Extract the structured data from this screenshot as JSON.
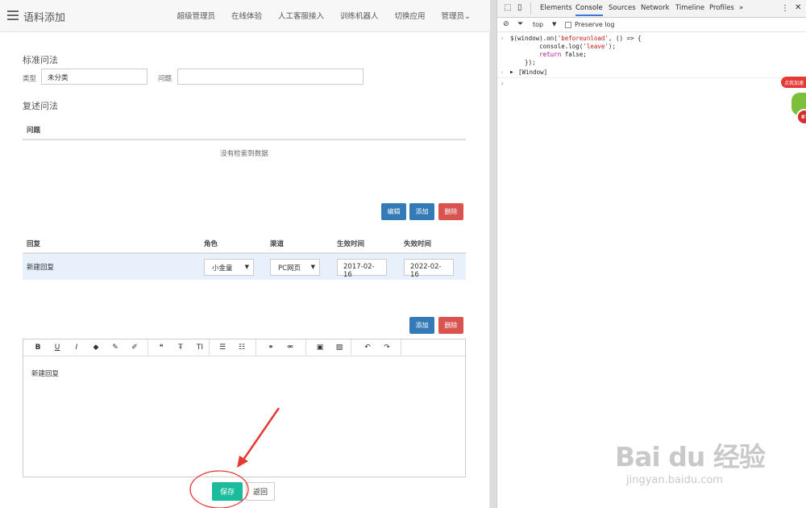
{
  "app": {
    "title": "语料添加",
    "nav": [
      "超级管理员",
      "在线体验",
      "人工客服接入",
      "训练机器人",
      "切换应用",
      "管理员"
    ]
  },
  "standard": {
    "heading": "标准问法",
    "type_label": "类型",
    "type_value": "未分类",
    "question_label": "问题",
    "question_value": ""
  },
  "paraphrase": {
    "heading": "复述问法",
    "column": "问题",
    "empty_text": "没有检索到数据",
    "edit_button": "编辑",
    "add_button": "添加",
    "delete_button": "删除"
  },
  "reply_table": {
    "headers": [
      "回复",
      "角色",
      "渠道",
      "生效时间",
      "失效时间"
    ],
    "row": {
      "reply": "新建回复",
      "role": "小金童",
      "channel": "PC网页",
      "start": "2017-02-16",
      "end": "2022-02-16"
    },
    "add_button": "添加",
    "delete_button": "删除"
  },
  "editor": {
    "toolbar_icons": [
      "bold-icon",
      "underline-icon",
      "italic-icon",
      "eraser-icon",
      "pencil-icon",
      "brush-icon",
      "quote-icon",
      "font-icon",
      "text-size-icon",
      "unordered-list-icon",
      "ordered-list-icon",
      "link-icon",
      "unlink-icon",
      "video-icon",
      "image-icon",
      "undo-icon",
      "redo-icon"
    ],
    "toolbar_glyphs": [
      "B",
      "U",
      "I",
      "◆",
      "✎",
      "✐",
      "❝",
      "Ŧ",
      "TI",
      "☰",
      "☷",
      "⚭",
      "⚮",
      "▣",
      "▨",
      "↶",
      "↷"
    ],
    "content": "新建回复"
  },
  "actions": {
    "save": "保存",
    "back": "返回"
  },
  "devtools": {
    "tabs": [
      "Elements",
      "Console",
      "Sources",
      "Network",
      "Timeline",
      "Profiles",
      "»"
    ],
    "active_tab": "Console",
    "context": "top",
    "preserve_log": "Preserve log",
    "code_lines": [
      "$(window).on('beforeunload', () => {",
      "        console.log('leave');",
      "        return false;",
      "    });"
    ],
    "result": "[Window]"
  },
  "overlay": {
    "badge_text": "点我加速",
    "badge_number": "87"
  },
  "watermark": {
    "brand": "Bai du 经验",
    "url": "jingyan.baidu.com"
  },
  "colors": {
    "primary": "#337ab7",
    "danger": "#d9534f",
    "success": "#1abc9c",
    "annotation": "#e53935"
  }
}
